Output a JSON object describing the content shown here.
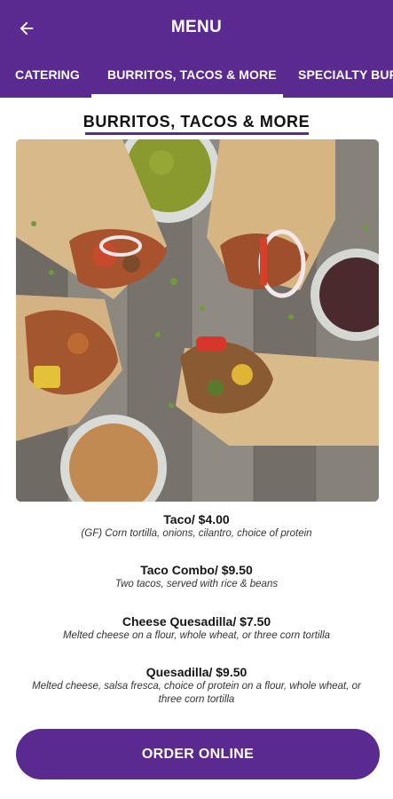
{
  "header": {
    "title": "MENU",
    "back_icon": "arrow-left-icon"
  },
  "tabs": [
    {
      "label": "CATERING",
      "active": false
    },
    {
      "label": "BURRITOS, TACOS & MORE",
      "active": true
    },
    {
      "label": "SPECIALTY BUR",
      "active": false
    }
  ],
  "section": {
    "heading": "BURRITOS, TACOS & MORE"
  },
  "menu_items": [
    {
      "name": "Taco/ $4.00",
      "description": "(GF) Corn tortilla, onions, cilantro, choice of protein"
    },
    {
      "name": "Taco Combo/ $9.50",
      "description": "Two tacos, served with rice & beans"
    },
    {
      "name": "Cheese Quesadilla/ $7.50",
      "description": "Melted cheese on a flour, whole wheat, or three corn tortilla"
    },
    {
      "name": "Quesadilla/ $9.50",
      "description": "Melted cheese, salsa fresca, choice of protein on a flour, whole wheat, or three corn tortilla"
    }
  ],
  "order_button": {
    "label": "ORDER ONLINE"
  },
  "colors": {
    "brand": "#5b2a91",
    "background": "#ffffff"
  }
}
